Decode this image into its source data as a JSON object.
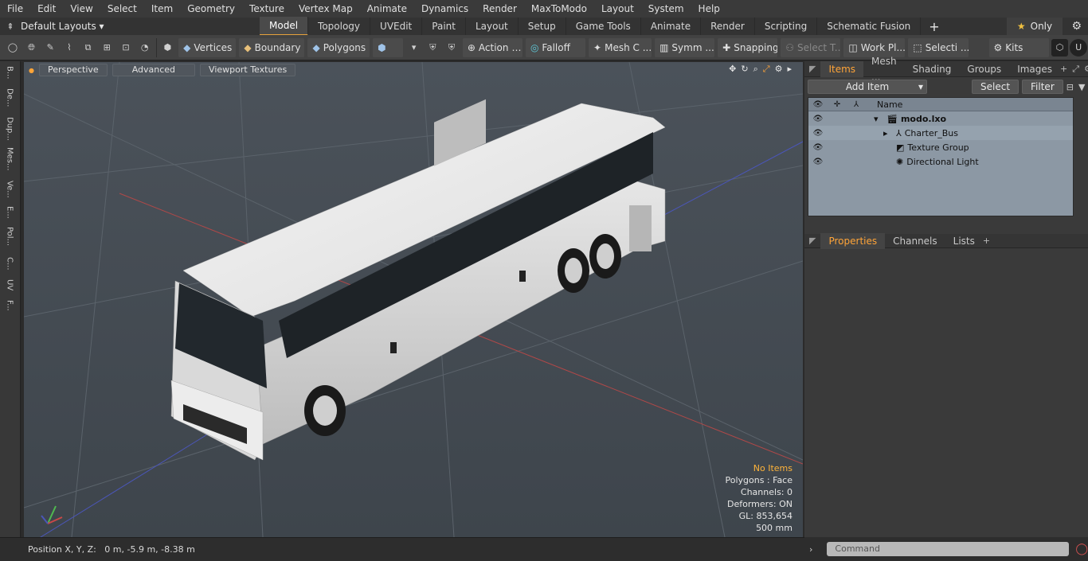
{
  "menu": [
    "File",
    "Edit",
    "View",
    "Select",
    "Item",
    "Geometry",
    "Texture",
    "Vertex Map",
    "Animate",
    "Dynamics",
    "Render",
    "MaxToModo",
    "Layout",
    "System",
    "Help"
  ],
  "layout": {
    "default_label": "Default Layouts",
    "tabs": [
      "Model",
      "Topology",
      "UVEdit",
      "Paint",
      "Layout",
      "Setup",
      "Game Tools",
      "Animate",
      "Render",
      "Scripting",
      "Schematic Fusion"
    ],
    "active_tab": "Model",
    "only_label": "Only"
  },
  "toolbar": {
    "vertices": "Vertices",
    "boundary": "Boundary",
    "polygons": "Polygons",
    "action": "Action",
    "falloff": "Falloff",
    "mesh": "Mesh C ...",
    "symm": "Symm ...",
    "snapping": "Snapping",
    "select_t": "Select T...",
    "workpl": "Work Pl...",
    "selecti": "Selecti ...",
    "kits": "Kits"
  },
  "left_tabs": [
    "B...",
    "De...",
    "Dup...",
    "Mes...",
    "Ve...",
    "E...",
    "Pol...",
    "C...",
    "UV",
    "F..."
  ],
  "viewport": {
    "perspective": "Perspective",
    "advanced": "Advanced",
    "textures": "Viewport Textures",
    "stats": {
      "no_items": "No Items",
      "polygons": "Polygons : Face",
      "channels": "Channels: 0",
      "deformers": "Deformers: ON",
      "gl": "GL: 853,654",
      "unit": "500 mm"
    }
  },
  "status": {
    "position": "Position X, Y, Z:   0 m, -5.9 m, -8.38 m"
  },
  "items_panel": {
    "tabs": [
      "Items",
      "Mesh ...",
      "Shading",
      "Groups",
      "Images"
    ],
    "active_tab": "Items",
    "add_item": "Add Item",
    "select": "Select",
    "filter": "Filter",
    "name_header": "Name",
    "rows": [
      {
        "name": "modo.lxo"
      },
      {
        "name": "Charter_Bus"
      },
      {
        "name": "Texture Group"
      },
      {
        "name": "Directional Light"
      }
    ]
  },
  "props_panel": {
    "tabs": [
      "Properties",
      "Channels",
      "Lists"
    ],
    "active_tab": "Properties"
  },
  "command": {
    "placeholder": "Command"
  },
  "colors": {
    "accent": "#ffa438",
    "viewport_bg": "#495057",
    "tree_bg": "#8c98a4"
  }
}
